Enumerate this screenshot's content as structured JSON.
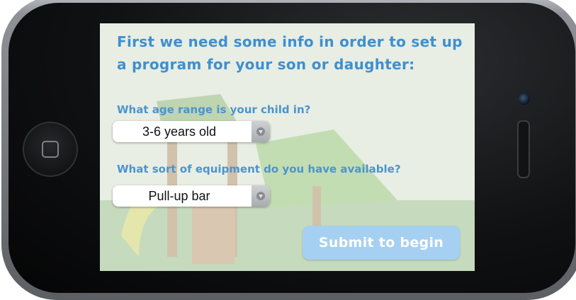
{
  "screen": {
    "title": "First we need some info in order to set up a program for your son or daughter:",
    "age_question": {
      "label": "What age range is your child in?",
      "selected": "3-6 years old"
    },
    "equipment_question": {
      "label": "What sort of equipment do you have available?",
      "selected": "Pull-up bar"
    },
    "submit_label": "Submit to begin"
  },
  "colors": {
    "heading": "#3f8fd0",
    "label": "#4b94cf",
    "submit_bg": "#a5d0f2",
    "submit_text": "#ffffff"
  },
  "icons": {
    "home_button": "home-square-icon",
    "select_arrow": "chevron-down-icon"
  }
}
